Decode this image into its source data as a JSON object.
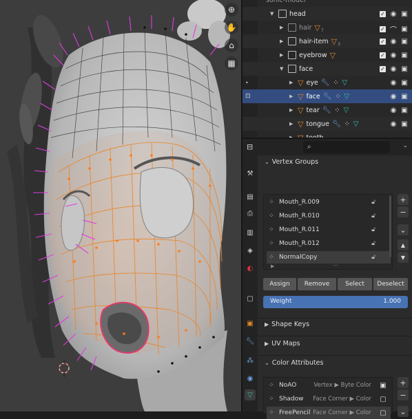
{
  "viewport": {
    "tools": [
      {
        "icon": "zoom-icon",
        "glyph": "⊕"
      },
      {
        "icon": "hand-icon",
        "glyph": "✋"
      },
      {
        "icon": "camera-icon",
        "glyph": "⌂"
      },
      {
        "icon": "grid-icon",
        "glyph": "▦"
      }
    ]
  },
  "outliner": {
    "partial_top": "sonic-model",
    "rows": [
      {
        "name": "head",
        "kind": "object",
        "dim": false
      },
      {
        "name": "hair",
        "kind": "object",
        "dim": true,
        "count": "7"
      },
      {
        "name": "hair-item",
        "kind": "object",
        "dim": false,
        "count": "3"
      },
      {
        "name": "eyebrow",
        "kind": "object",
        "dim": false
      },
      {
        "name": "face",
        "kind": "object",
        "dim": false
      },
      {
        "name": "eye",
        "kind": "mesh",
        "dim": false
      },
      {
        "name": "face",
        "kind": "mesh",
        "dim": false,
        "selected": true
      },
      {
        "name": "tear",
        "kind": "mesh",
        "dim": false
      },
      {
        "name": "tongue",
        "kind": "mesh",
        "dim": false
      },
      {
        "name": "tooth",
        "kind": "mesh",
        "dim": false
      }
    ]
  },
  "props": {
    "search_placeholder": "",
    "vertex_groups": {
      "title": "Vertex Groups",
      "items": [
        "Mouth_R.009",
        "Mouth_R.010",
        "Mouth_R.011",
        "Mouth_R.012",
        "NormalCopy"
      ],
      "selected_index": 4,
      "buttons": {
        "assign": "Assign",
        "remove": "Remove",
        "select": "Select",
        "deselect": "Deselect"
      },
      "weight_label": "Weight",
      "weight_value": "1.000"
    },
    "shape_keys_title": "Shape Keys",
    "uv_maps_title": "UV Maps",
    "color_attributes": {
      "title": "Color Attributes",
      "items": [
        {
          "name": "NoAO",
          "type": "Vertex ▶ Byte Color"
        },
        {
          "name": "Shadow",
          "type": "Face Corner ▶ Color"
        },
        {
          "name": "FreePencil",
          "type": "Face Corner ▶ Color"
        }
      ]
    }
  },
  "colors": {
    "selection": "#334d80",
    "weight_bar": "#4772b3",
    "mesh_edges_selected": "#e8852a",
    "normals": "#e03be0",
    "mesh_icon": "#e08a2a"
  }
}
